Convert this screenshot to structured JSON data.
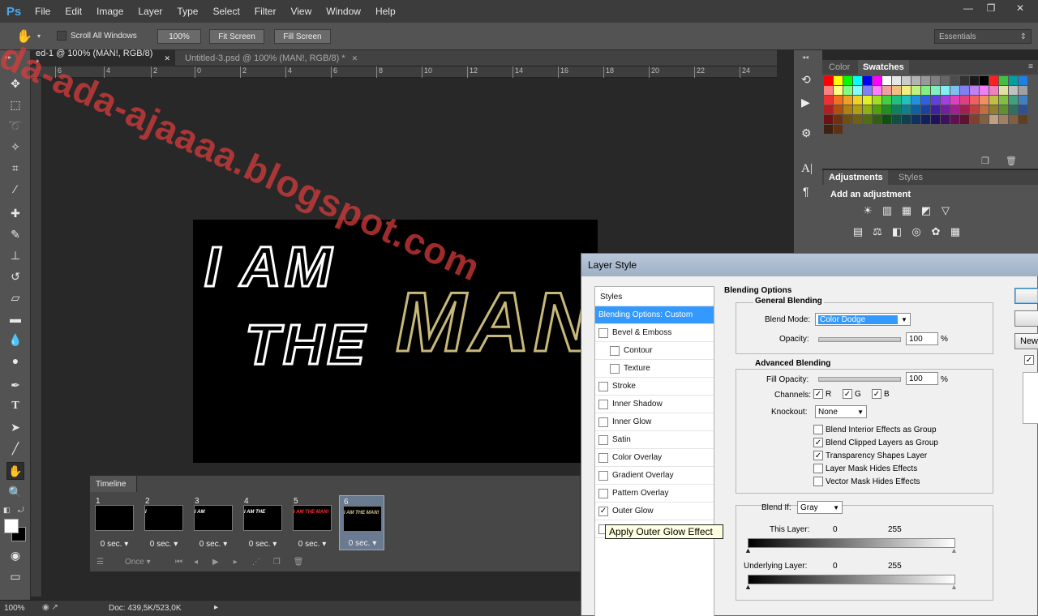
{
  "app": {
    "logo": "Ps"
  },
  "menu": [
    "File",
    "Edit",
    "Image",
    "Layer",
    "Type",
    "Select",
    "Filter",
    "View",
    "Window",
    "Help"
  ],
  "window_controls": {
    "minimize": "—",
    "restore": "❐",
    "close": "✕"
  },
  "options": {
    "scroll_all_label": "Scroll All Windows",
    "zoom_btn": "100%",
    "fit_screen": "Fit Screen",
    "fill_screen": "Fill Screen",
    "workspace": "Essentials"
  },
  "tabs": [
    {
      "label": "ed-1 @ 100% (MAN!, RGB/8) *",
      "close": "✕"
    },
    {
      "label": "Untitled-3.psd @ 100% (MAN!, RGB/8) *",
      "close": "✕"
    }
  ],
  "ruler_ticks": [
    "6",
    "4",
    "2",
    "0",
    "2",
    "4",
    "6",
    "8",
    "10",
    "12",
    "14",
    "16",
    "18",
    "20",
    "22",
    "24"
  ],
  "canvas_text": {
    "line1": "I AM",
    "line2": "THE",
    "line3": "MAN!"
  },
  "timeline": {
    "title": "Timeline",
    "frames": [
      {
        "num": "1",
        "delay": "0 sec.",
        "text": ""
      },
      {
        "num": "2",
        "delay": "0 sec.",
        "text": "I"
      },
      {
        "num": "3",
        "delay": "0 sec.",
        "text": "I AM"
      },
      {
        "num": "4",
        "delay": "0 sec.",
        "text": "I AM THE"
      },
      {
        "num": "5",
        "delay": "0 sec.",
        "text": "I AM THE MAN!"
      },
      {
        "num": "6",
        "delay": "0 sec.",
        "text": "I AM THE MAN!"
      }
    ],
    "loop": "Once"
  },
  "status": {
    "zoom": "100%",
    "doc": "Doc: 439,5K/523,0K"
  },
  "panels": {
    "color_tab": "Color",
    "swatches_tab": "Swatches",
    "adjustments_tab": "Adjustments",
    "styles_tab": "Styles",
    "add_adjustment": "Add an adjustment"
  },
  "swatch_rows": [
    [
      "#ff0000",
      "#ffff00",
      "#00ff00",
      "#00ffff",
      "#0000ff",
      "#ff00ff",
      "#ffffff",
      "#e6e6e6",
      "#cccccc",
      "#b3b3b3",
      "#999999",
      "#808080",
      "#666666",
      "#4d4d4d",
      "#333333",
      "#1a1a1a",
      "#000000",
      "#ff2020",
      "#40c040",
      "#00a0a0",
      "#2080e0"
    ],
    [
      "#ff8080",
      "#ffff80",
      "#80ff80",
      "#80ffff",
      "#8080ff",
      "#ff80ff",
      "#f0a0a0",
      "#f0c080",
      "#f0f080",
      "#c0f080",
      "#80f080",
      "#80f0c0",
      "#80f0f0",
      "#80c0f0",
      "#8080f0",
      "#c080f0",
      "#f080f0",
      "#f080c0",
      "#e0e0a0",
      "#c0c0c0",
      "#a0a0a0"
    ],
    [
      "#ee3030",
      "#f07020",
      "#f0a020",
      "#f0d020",
      "#e0f020",
      "#a0e020",
      "#40d040",
      "#20c080",
      "#20c0c0",
      "#2090e0",
      "#3060e0",
      "#6040e0",
      "#a040e0",
      "#e040c0",
      "#e04080",
      "#f06060",
      "#f09060",
      "#c0c040",
      "#80c040",
      "#40a080",
      "#4080c0"
    ],
    [
      "#b02020",
      "#b05010",
      "#b08010",
      "#b0a010",
      "#90b010",
      "#50a010",
      "#209020",
      "#108060",
      "#108090",
      "#1060a0",
      "#2040a0",
      "#4020a0",
      "#7020a0",
      "#a02090",
      "#a02050",
      "#c04040",
      "#c07040",
      "#908030",
      "#609030",
      "#307060",
      "#305090"
    ],
    [
      "#701010",
      "#703010",
      "#705010",
      "#706010",
      "#507010",
      "#306010",
      "#105010",
      "#105040",
      "#104050",
      "#103060",
      "#102060",
      "#201060",
      "#401060",
      "#601050",
      "#601030",
      "#804030",
      "#806040",
      "#c0a080",
      "#a08060",
      "#806040",
      "#604020"
    ],
    [
      "#402010",
      "#603010"
    ]
  ],
  "dialog": {
    "title": "Layer Style",
    "styles_header": "Styles",
    "items": [
      {
        "label": "Blending Options: Custom",
        "checked": false,
        "selected": true,
        "indent": false,
        "check": false
      },
      {
        "label": "Bevel & Emboss",
        "checked": false,
        "indent": false,
        "check": true
      },
      {
        "label": "Contour",
        "checked": false,
        "indent": true,
        "check": true
      },
      {
        "label": "Texture",
        "checked": false,
        "indent": true,
        "check": true
      },
      {
        "label": "Stroke",
        "checked": false,
        "indent": false,
        "check": true
      },
      {
        "label": "Inner Shadow",
        "checked": false,
        "indent": false,
        "check": true
      },
      {
        "label": "Inner Glow",
        "checked": false,
        "indent": false,
        "check": true
      },
      {
        "label": "Satin",
        "checked": false,
        "indent": false,
        "check": true
      },
      {
        "label": "Color Overlay",
        "checked": false,
        "indent": false,
        "check": true
      },
      {
        "label": "Gradient Overlay",
        "checked": false,
        "indent": false,
        "check": true
      },
      {
        "label": "Pattern Overlay",
        "checked": false,
        "indent": false,
        "check": true
      },
      {
        "label": "Outer Glow",
        "checked": true,
        "indent": false,
        "check": true
      },
      {
        "label": "Drop Shadow",
        "checked": false,
        "indent": false,
        "check": true
      }
    ],
    "blending_options": "Blending Options",
    "general_blending": "General Blending",
    "blend_mode_label": "Blend Mode:",
    "blend_mode": "Color Dodge",
    "opacity_label": "Opacity:",
    "opacity": "100",
    "pct": "%",
    "advanced_blending": "Advanced Blending",
    "fill_opacity_label": "Fill Opacity:",
    "fill_opacity": "100",
    "channels_label": "Channels:",
    "ch_r": "R",
    "ch_g": "G",
    "ch_b": "B",
    "knockout_label": "Knockout:",
    "knockout": "None",
    "opts": [
      {
        "label": "Blend Interior Effects as Group",
        "checked": false
      },
      {
        "label": "Blend Clipped Layers as Group",
        "checked": true
      },
      {
        "label": "Transparency Shapes Layer",
        "checked": true
      },
      {
        "label": "Layer Mask Hides Effects",
        "checked": false
      },
      {
        "label": "Vector Mask Hides Effects",
        "checked": false
      }
    ],
    "blend_if_label": "Blend If:",
    "blend_if": "Gray",
    "this_layer": "This Layer:",
    "underlying_layer": "Underlying Layer:",
    "v0": "0",
    "v255": "255",
    "btn_new": "New"
  },
  "tooltip": "Apply Outer Glow Effect",
  "watermark": "ada-ada-ajaaaa.blogspot.com"
}
